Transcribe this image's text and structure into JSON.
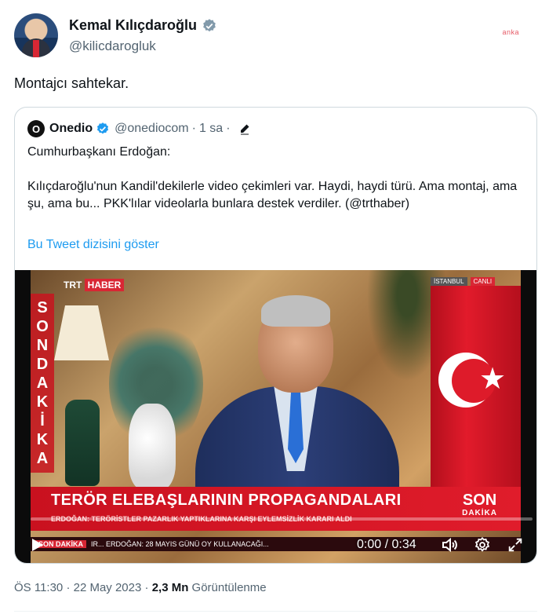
{
  "author": {
    "name": "Kemal Kılıçdaroğlu",
    "handle": "@kilicdarogluk",
    "avatar_icon": "profile-photo",
    "verified_color": "#829aab"
  },
  "watermark": "anka",
  "tweet": {
    "text": "Montajcı sahtekar."
  },
  "quoted": {
    "avatar_letter": "O",
    "name": "Onedio",
    "handle": "@onediocom",
    "separator": "·",
    "time": "1 sa",
    "body_p1": "Cumhurbaşkanı Erdoğan:",
    "body_p2": "Kılıçdaroğlu'nun Kandil'dekilerle video çekimleri var. Haydi, haydi türü. Ama montaj, ama şu, ama bu... PKK'lılar videolarla bunlara destek verdiler. (@trthaber)",
    "thread_link": "Bu Tweet dizisini göster",
    "verified_color": "#1d9bf0"
  },
  "video": {
    "channel_logo_a": "TRT",
    "channel_logo_b": "HABER",
    "location_label": "İSTANBUL",
    "live_label": "CANLI",
    "side_banner": [
      "S",
      "O",
      "N",
      "D",
      "A",
      "K",
      "İ",
      "K",
      "A"
    ],
    "headline": "TERÖR ELEBAŞLARININ PROPAGANDALARI",
    "subheadline": "ERDOĞAN: TERÖRİSTLER PAZARLIK YAPTIKLARINA KARŞI EYLEMSİZLİK KARARI ALDI",
    "brand_big": "SON",
    "brand_small": "DAKİKA",
    "ticker_tag": "SON DAKİKA",
    "ticker_text": "IR... ERDOĞAN: 28 MAYIS GÜNÜ OY KULLANACAĞI...",
    "time_display": "0:00 / 0:34",
    "progress": 0.0
  },
  "footer": {
    "time": "ÖS 11:30",
    "separator": "·",
    "date": "22 May 2023",
    "views_count": "2,3 Mn",
    "views_label": "Görüntülenme"
  }
}
